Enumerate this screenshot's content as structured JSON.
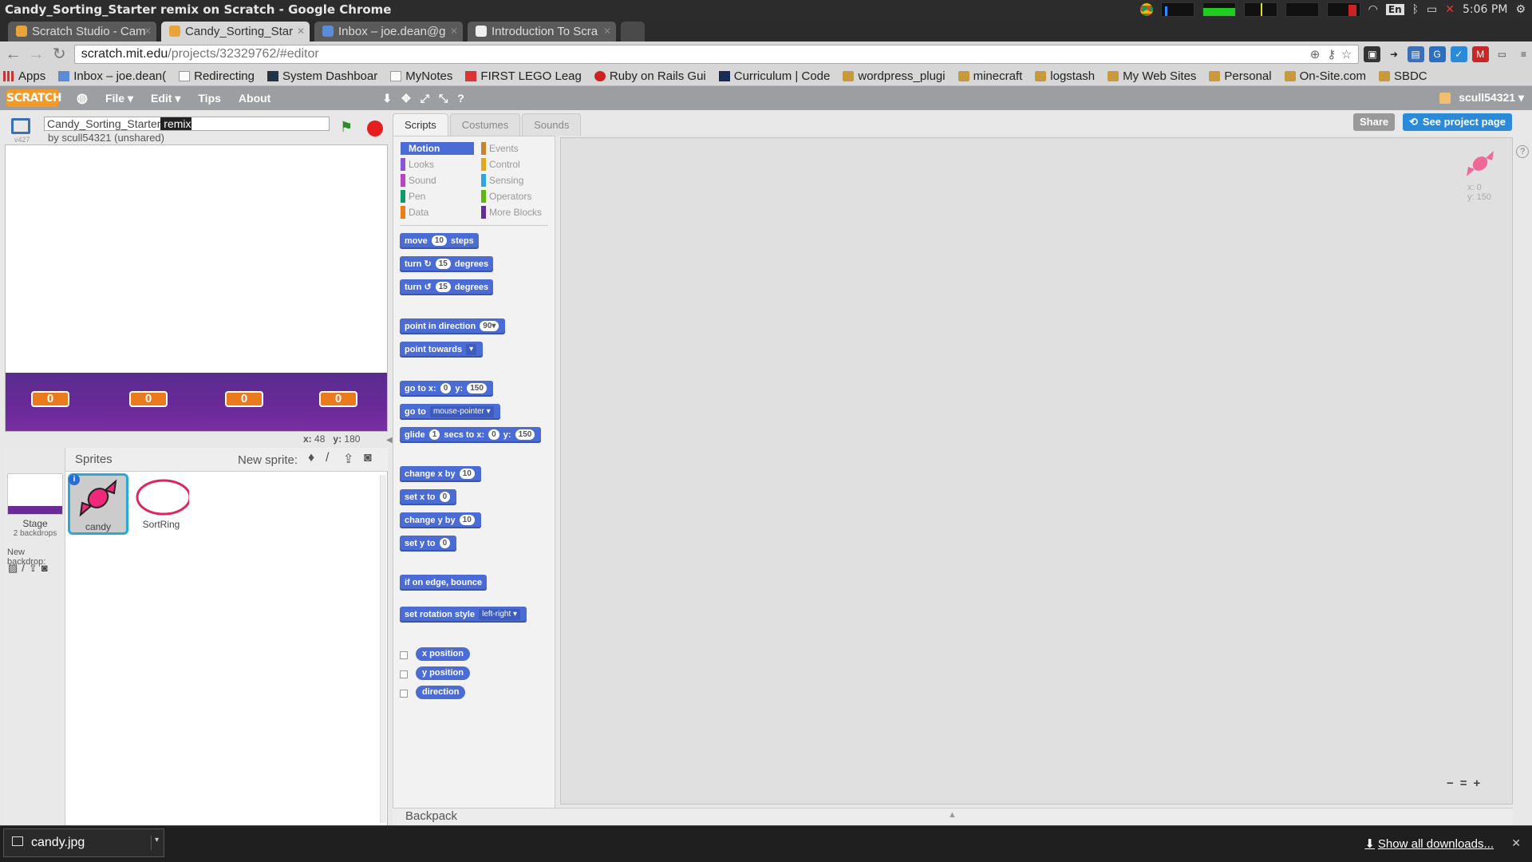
{
  "window": {
    "title": "Candy_Sorting_Starter remix on Scratch - Google Chrome",
    "clock": "5:06 PM",
    "lang": "En"
  },
  "tabs": [
    {
      "label": "Scratch Studio - Cam",
      "active": false
    },
    {
      "label": "Candy_Sorting_Star",
      "active": true
    },
    {
      "label": "Inbox – joe.dean@g",
      "active": false
    },
    {
      "label": "Introduction To Scra",
      "active": false
    }
  ],
  "address": {
    "host": "scratch.mit.edu",
    "path": "/projects/32329762/#editor"
  },
  "bookmarks": [
    "Apps",
    "Inbox – joe.dean(",
    "Redirecting",
    "System Dashboar",
    "MyNotes",
    "FIRST LEGO Leag",
    "Ruby on Rails Gui",
    "Curriculum | Code",
    "wordpress_plugi",
    "minecraft",
    "logstash",
    "My Web Sites",
    "Personal",
    "On-Site.com",
    "SBDC"
  ],
  "menu": {
    "logo": "SCRATCH",
    "items": [
      "File ▾",
      "Edit ▾",
      "Tips",
      "About"
    ],
    "user": "scull54321 ▾"
  },
  "project": {
    "title": "Candy_Sorting_Starter",
    "title_selected": " remix",
    "byline": "by scull54321 (unshared)",
    "version": "v427"
  },
  "stage": {
    "counters": [
      "0",
      "0",
      "0",
      "0"
    ],
    "mouse_x_label": "x:",
    "mouse_x": "48",
    "mouse_y_label": "y:",
    "mouse_y": "180"
  },
  "sprites": {
    "header": "Sprites",
    "new_sprite": "New sprite:",
    "stage_label": "Stage",
    "stage_sub": "2 backdrops",
    "new_backdrop": "New backdrop:",
    "items": [
      "candy",
      "SortRing"
    ]
  },
  "editor_tabs": [
    "Scripts",
    "Costumes",
    "Sounds"
  ],
  "categories": {
    "left": [
      {
        "name": "Motion",
        "color": "#4a6cd4"
      },
      {
        "name": "Looks",
        "color": "#8a55d7"
      },
      {
        "name": "Sound",
        "color": "#bb42c3"
      },
      {
        "name": "Pen",
        "color": "#0e9a6c"
      },
      {
        "name": "Data",
        "color": "#ee7d16"
      }
    ],
    "right": [
      {
        "name": "Events",
        "color": "#c88330"
      },
      {
        "name": "Control",
        "color": "#e1a91a"
      },
      {
        "name": "Sensing",
        "color": "#2ca5e2"
      },
      {
        "name": "Operators",
        "color": "#5cb712"
      },
      {
        "name": "More Blocks",
        "color": "#632d99"
      }
    ]
  },
  "blocks": {
    "move": {
      "a": "move",
      "n": "10",
      "b": "steps"
    },
    "turn_cw": {
      "a": "turn",
      "n": "15",
      "b": "degrees"
    },
    "turn_ccw": {
      "a": "turn",
      "n": "15",
      "b": "degrees"
    },
    "point_dir": {
      "a": "point in direction",
      "n": "90▾"
    },
    "point_towards": {
      "a": "point towards",
      "d": "▾"
    },
    "goto_xy": {
      "a": "go to x:",
      "x": "0",
      "b": "y:",
      "y": "150"
    },
    "goto": {
      "a": "go to",
      "d": "mouse-pointer ▾"
    },
    "glide": {
      "a": "glide",
      "n": "1",
      "b": "secs to x:",
      "x": "0",
      "c": "y:",
      "y": "150"
    },
    "change_x": {
      "a": "change x by",
      "n": "10"
    },
    "set_x": {
      "a": "set x to",
      "n": "0"
    },
    "change_y": {
      "a": "change y by",
      "n": "10"
    },
    "set_y": {
      "a": "set y to",
      "n": "0"
    },
    "bounce": {
      "a": "if on edge, bounce"
    },
    "rotation": {
      "a": "set rotation style",
      "d": "left-right ▾"
    },
    "reporters": [
      "x position",
      "y position",
      "direction"
    ]
  },
  "script_area": {
    "sprite_x": "x: 0",
    "sprite_y": "y: 150",
    "zoom": [
      "−",
      "=",
      "+"
    ]
  },
  "buttons": {
    "share": "Share",
    "see_project": "See project page"
  },
  "backpack": "Backpack",
  "download": {
    "file": "candy.jpg",
    "show_all": "Show all downloads..."
  }
}
